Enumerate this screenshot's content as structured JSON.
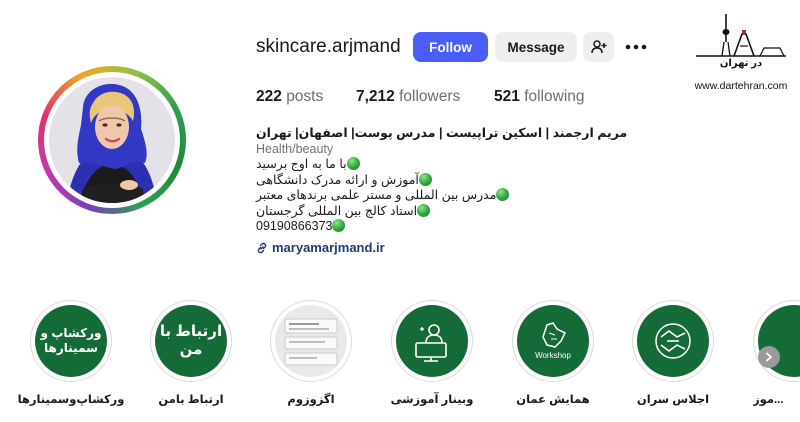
{
  "profile": {
    "username": "skincare.arjmand",
    "follow_label": "Follow",
    "message_label": "Message",
    "posts_count": "222",
    "posts_label": "posts",
    "followers_count": "7,212",
    "followers_label": "followers",
    "following_count": "521",
    "following_label": "following"
  },
  "bio": {
    "name": "مریم ارجمند | اسکین تراپیست | مدرس پوست| اصفهان| تهران",
    "category": "Health/beauty",
    "lines": [
      "با ما به اوج برسید",
      "آموزش و ارائه مدرک دانشگاهی",
      "مدرس بین المللی و مستر علمی برندهای معتبر",
      "استاد کالج بین المللی گرجستان",
      "09190866373"
    ],
    "link": "maryamarjmand.ir"
  },
  "watermark": {
    "brand": "در تهران",
    "url": "www.dartehran.com"
  },
  "highlights": [
    {
      "label": "ورکشاپ‌وسمینارها",
      "cover_text": "ورکشاپ و سمینارها"
    },
    {
      "label": "ارتباط بامن",
      "cover_text": "ارتباط با من"
    },
    {
      "label": "اگزوزوم"
    },
    {
      "label": "وبینار آموزشی"
    },
    {
      "label": "همایش عمان",
      "cover_text": "Workshop"
    },
    {
      "label": "اجلاس سران"
    },
    {
      "label": "موز..."
    }
  ],
  "colors": {
    "follow": "#4a5df9",
    "highlight_green": "#156b38",
    "link": "#203a70"
  },
  "icons": [
    "add-user-icon",
    "more-icon",
    "link-icon",
    "chevron-right-icon"
  ]
}
